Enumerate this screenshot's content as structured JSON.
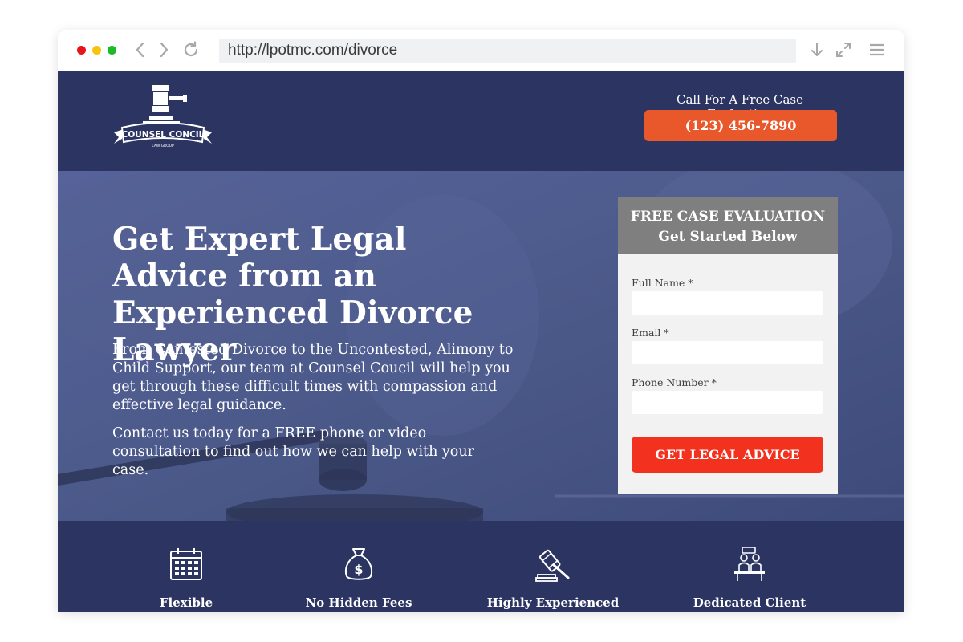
{
  "browser": {
    "url": "http://lpotmc.com/divorce"
  },
  "header": {
    "logo_text": "COUNSEL CONCIL",
    "logo_subtext": "LAW GROUP",
    "call_label": "Call For A Free Case Evaluation",
    "phone": "(123) 456-7890"
  },
  "hero": {
    "title": "Get Expert Legal Advice from an Experienced Divorce Lawyer",
    "paragraph1": "From Contested Divorce to the Uncontested, Alimony to Child Support, our team at Counsel Coucil will help you get through these difficult times with compassion and effective legal guidance.",
    "paragraph2": "Contact us today for a FREE phone or video consultation to find out how we can help with your case."
  },
  "form": {
    "heading_line1": "FREE CASE EVALUATION",
    "heading_line2": "Get Started Below",
    "fields": [
      {
        "label": "Full Name *",
        "value": ""
      },
      {
        "label": "Email *",
        "value": ""
      },
      {
        "label": "Phone Number *",
        "value": ""
      }
    ],
    "submit_label": "GET LEGAL ADVICE"
  },
  "features": [
    {
      "label": "Flexible",
      "icon": "calendar-icon"
    },
    {
      "label": "No Hidden Fees",
      "icon": "money-bag-icon"
    },
    {
      "label": "Highly Experienced",
      "icon": "gavel-icon"
    },
    {
      "label": "Dedicated Client",
      "icon": "client-desk-icon"
    }
  ],
  "colors": {
    "navy": "#2c3561",
    "hero_overlay": "#4a5888",
    "phone_button": "#e8582b",
    "submit_button": "#f2321f",
    "form_header": "#7f7f7f"
  }
}
